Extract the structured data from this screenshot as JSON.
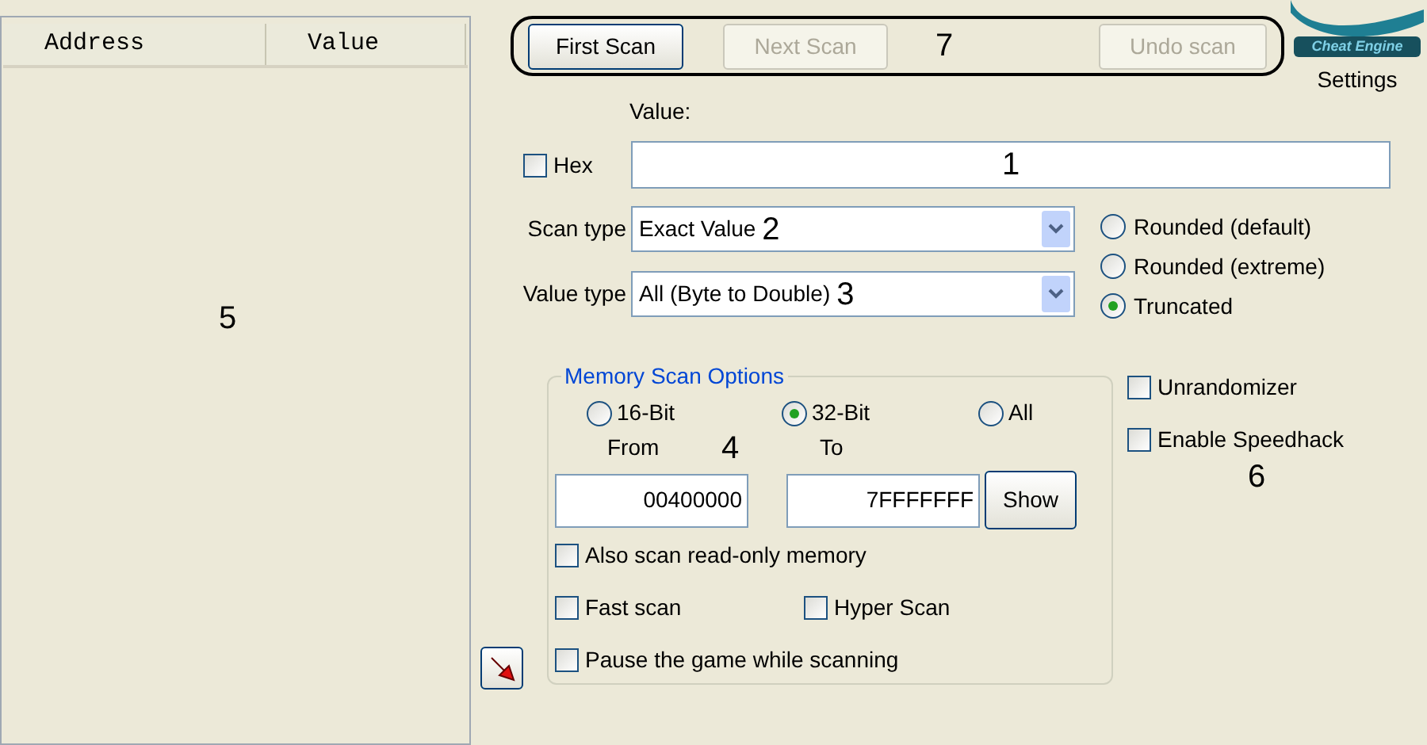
{
  "address_list": {
    "columns": [
      "Address",
      "Value"
    ],
    "marker": "5"
  },
  "scan_bar": {
    "buttons": [
      {
        "label": "First Scan",
        "disabled": false
      },
      {
        "label": "Next Scan",
        "disabled": true
      },
      {
        "label": "Undo scan",
        "disabled": true
      }
    ],
    "marker": "7"
  },
  "logo": {
    "text": "Cheat Engine"
  },
  "settings_label": "Settings",
  "value": {
    "label": "Value:",
    "hex": {
      "label": "Hex",
      "checked": false
    },
    "marker": "1"
  },
  "scan_type": {
    "label": "Scan type",
    "value": "Exact Value",
    "marker": "2"
  },
  "value_type": {
    "label": "Value type",
    "value": "All (Byte to Double)",
    "marker": "3"
  },
  "rounding": [
    {
      "label": "Rounded (default)",
      "selected": false
    },
    {
      "label": "Rounded (extreme)",
      "selected": false
    },
    {
      "label": "Truncated",
      "selected": true
    }
  ],
  "memory_scan_options": {
    "title": "Memory Scan Options",
    "bits": [
      {
        "label": "16-Bit",
        "selected": false
      },
      {
        "label": "32-Bit",
        "selected": true
      },
      {
        "label": "All",
        "selected": false
      }
    ],
    "from_label": "From",
    "to_label": "To",
    "marker": "4",
    "from": "00400000",
    "to": "7FFFFFFF",
    "show_button": "Show",
    "options": [
      {
        "label": "Also scan read-only memory",
        "checked": false
      },
      {
        "label": "Fast scan",
        "checked": false
      },
      {
        "label": "Hyper Scan",
        "checked": false
      },
      {
        "label": "Pause the game while scanning",
        "checked": false
      }
    ]
  },
  "extras": {
    "options": [
      {
        "label": "Unrandomizer",
        "checked": false
      },
      {
        "label": "Enable Speedhack",
        "checked": false
      }
    ],
    "marker": "6"
  }
}
